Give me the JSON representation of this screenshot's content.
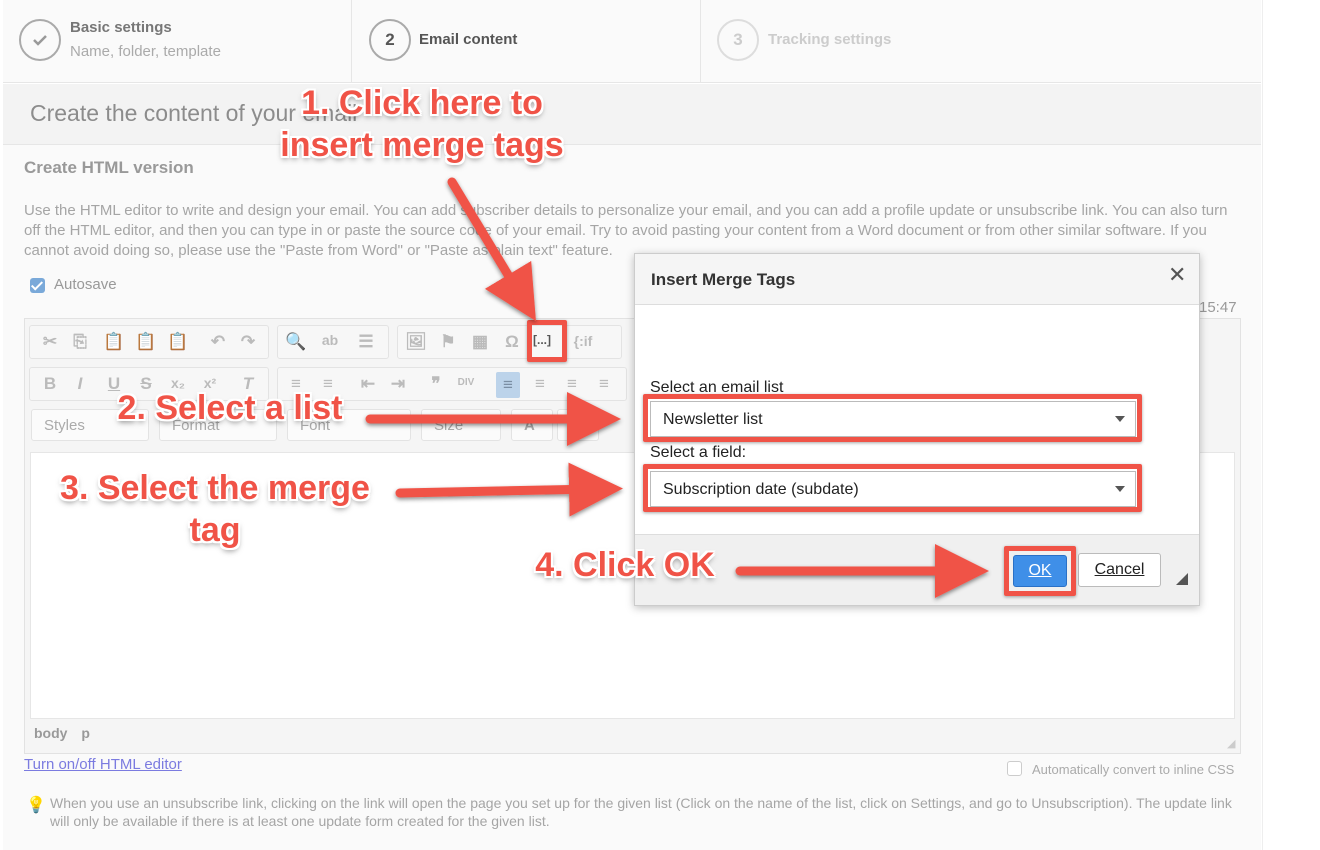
{
  "wizard": {
    "steps": [
      {
        "title": "Basic settings",
        "subtitle": "Name, folder, template",
        "icon": "check-icon"
      },
      {
        "number": "2",
        "title": "Email content"
      },
      {
        "number": "3",
        "title": "Tracking settings"
      }
    ]
  },
  "panel": {
    "title": "Create the content of your email",
    "section_title": "Create HTML version",
    "description": "Use the HTML editor to write and design your email. You can add subscriber details to personalize your email, and you can add a profile update or unsubscribe link. You can also turn off the HTML editor, and then you can type in or paste the source code of your email. Try to avoid pasting your content from a Word document or from other similar software. If you cannot avoid doing so, please use the \"Paste from Word\" or \"Paste as plain text\" feature.",
    "autosave_label": "Autosave",
    "autosave_checked": true,
    "autosave_time": "15:47"
  },
  "editor": {
    "toolbar_row1_glyphs": [
      "✂",
      "⎘",
      "📋",
      "📋",
      "📋",
      "↶",
      "↷",
      "🔍",
      "ab",
      "☰",
      "🖼",
      "⚑",
      "▦",
      "Ω",
      "[...]",
      "{:if"
    ],
    "toolbar_row2_glyphs": [
      "B",
      "I",
      "U",
      "S",
      "x₂",
      "x²",
      "T",
      "≡",
      "≡",
      "⇤",
      "⇥",
      "❞",
      "DIV",
      "≡",
      "≡",
      "≡",
      "≡"
    ],
    "styles_label": "Styles",
    "format_label": "Format",
    "font_label": "Font",
    "size_label": "Size",
    "text_color_label": "A",
    "bg_color_label": "A",
    "elements_path": "body p",
    "toggle_link": "Turn on/off HTML editor",
    "inline_css_label": "Automatically convert to inline CSS",
    "inline_css_checked": false,
    "tip": "When you use an unsubscribe link, clicking on the link will open the page you set up for the given list (Click on the name of the list, click on Settings, and go to Unsubscription). The update link will only be available if there is at least one update form created for the given list."
  },
  "dialog": {
    "title": "Insert Merge Tags",
    "close_glyph": "✕",
    "list_label": "Select an email list",
    "list_value": "Newsletter list",
    "field_label": "Select a field:",
    "field_value": "Subscription date (subdate)",
    "ok_label": "OK",
    "cancel_label": "Cancel"
  },
  "annotations": {
    "step1": "1. Click here to insert merge tags",
    "step2": "2. Select a list",
    "step3": "3. Select the merge tag",
    "step4": "4. Click OK",
    "color": "#f05347"
  }
}
